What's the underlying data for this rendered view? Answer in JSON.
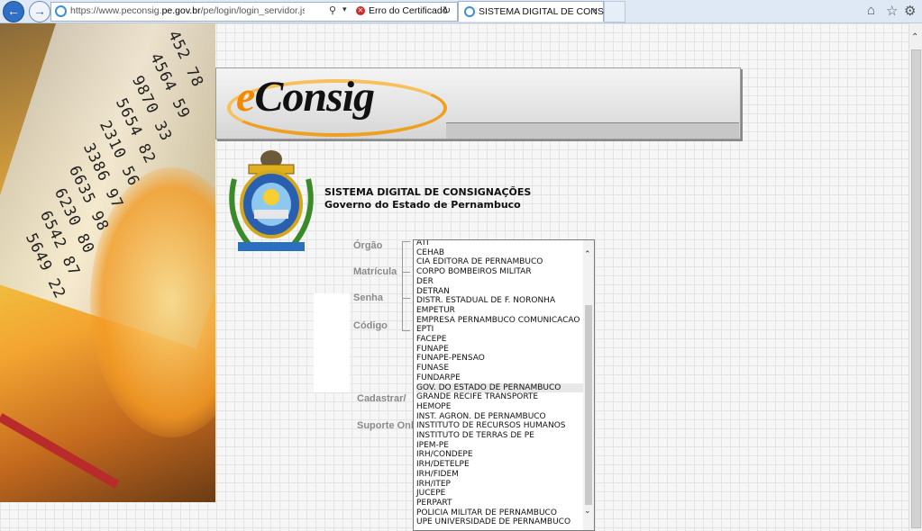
{
  "browser": {
    "url_prefix": "https://www.peconsig.",
    "url_domain": "pe.gov.br",
    "url_suffix": "/pe/login/login_servidor.jsp#no-ba",
    "certificate_error": "Erro do Certificado",
    "tab_title": "SISTEMA DIGITAL DE CONS...",
    "tab_close": "×"
  },
  "banner": {
    "logo_e": "e",
    "logo_rest": "Consig"
  },
  "header": {
    "title_line1": "SISTEMA DIGITAL DE CONSIGNAÇÕES",
    "title_line2": "Governo do Estado de Pernambuco"
  },
  "form": {
    "orgao_label": "Órgão",
    "matricula_label": "Matrícula",
    "senha_label": "Senha",
    "codigo_label": "Código",
    "cadastrar_link": "Cadastrar/",
    "suporte_link": "Suporte Onl"
  },
  "orgao_options": [
    "ATI",
    "CEHAB",
    "CIA EDITORA DE PERNAMBUCO",
    "CORPO BOMBEIROS MILITAR",
    "DER",
    "DETRAN",
    "DISTR. ESTADUAL DE F. NORONHA",
    "EMPETUR",
    "EMPRESA PERNAMBUCO COMUNICACAO",
    "EPTI",
    "FACEPE",
    "FUNAPE",
    "FUNAPE-PENSAO",
    "FUNASE",
    "FUNDARPE",
    "GOV. DO ESTADO DE PERNAMBUCO",
    "GRANDE RECIFE TRANSPORTE",
    "HEMOPE",
    "INST. AGRON. DE PERNAMBUCO",
    "INSTITUTO DE RECURSOS HUMANOS",
    "INSTITUTO DE TERRAS DE PE",
    "IPEM-PE",
    "IRH/CONDEPE",
    "IRH/DETELPE",
    "IRH/FIDEM",
    "IRH/ITEP",
    "JUCEPE",
    "PERPART",
    "POLICIA MILITAR DE PERNAMBUCO",
    "UPE UNIVERSIDADE DE PERNAMBUCO"
  ],
  "selected_option": "GOV. DO ESTADO DE PERNAMBUCO",
  "photo_numbers": [
    "452 78",
    "4564 59",
    "9870 33",
    "5654 82",
    "2310 56",
    "3386 97",
    "6635 98",
    "6230 80",
    "6542 87",
    "5649 22"
  ],
  "colors": {
    "logo_orange": "#f08a00",
    "chrome_blue": "#2f6fc4"
  }
}
